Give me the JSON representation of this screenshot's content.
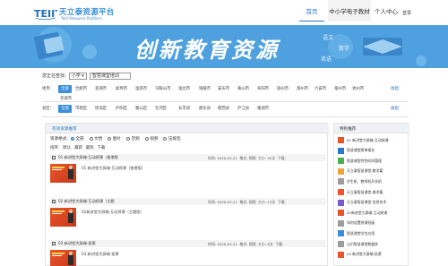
{
  "header": {
    "logo_mark": "TEIIT",
    "logo_cn": "天立泰资源平台",
    "logo_en": "Teiit Resource Platform",
    "nav": [
      "首页",
      "中小学电子教材",
      "个人中心"
    ],
    "login": "登录"
  },
  "banner": {
    "title": "创新教育资源",
    "color": "#4ea0df"
  },
  "search": {
    "label": "您正在查找:",
    "stage": "小学",
    "keyword": "智慧课堂培训"
  },
  "filters": {
    "region_label": "地市:",
    "regions": [
      "全部",
      "合肥市",
      "芜湖市",
      "蚌埠市",
      "淮南市",
      "马鞍山市",
      "淮北市",
      "铜陵市",
      "安庆市",
      "黄山市",
      "阜阳市",
      "宿州市",
      "滁州市",
      "六安市",
      "亳州市",
      "池州市",
      "宣城市"
    ],
    "county_label": "县区:",
    "counties": [
      "全部",
      "市辖区",
      "瑶海区",
      "庐阳区",
      "蜀山区",
      "包河区",
      "长丰县",
      "肥东县",
      "肥西县",
      "庐江县",
      "巢湖市"
    ],
    "collapse": "收起"
  },
  "main": {
    "panel_title": "有效资源推荐",
    "format_label": "资源格式:",
    "formats": [
      "全部",
      "文档",
      "图片",
      "音频",
      "视频",
      "压缩包"
    ],
    "sort_label": "排序:",
    "sorts": [
      "默认",
      "最新",
      "最热",
      "下载"
    ],
    "items": [
      {
        "title": "01 新讲堂大屏端-互动授课（香港版",
        "subtitle": "01 新讲堂大屏端-互动授课（香港版）",
        "time": "时间: 2020-03-21",
        "format": "格式: 视频",
        "size": "大小: 52文",
        "downloads": "下载:"
      },
      {
        "title": "02 新讲堂大屏端-互动授课（主题",
        "subtitle": "02新讲堂大屏端-互动授课（主题版）",
        "time": "时间: 2020-03-21",
        "format": "格式: 视频",
        "size": "大小: 13文",
        "downloads": "下载:"
      },
      {
        "title": "03 新讲堂大屏端-投票",
        "subtitle": "03 新讲堂大屏端-投票",
        "time": "时间: 2020-03-21",
        "format": "格式: 视频",
        "size": "大小: 8文",
        "downloads": "下载:"
      }
    ]
  },
  "side": {
    "title": "特别推荐",
    "items": [
      {
        "label": "01 新讲堂大屏端-互动授课",
        "color": "#e8552c"
      },
      {
        "label": "智慧课堂简单报名",
        "color": "#2a78c8"
      },
      {
        "label": "智慧课堂特色时间管理",
        "color": "#4caf50"
      },
      {
        "label": "天立泰智慧课堂-数学篇",
        "color": "#f2a23a"
      },
      {
        "label": "学生机、教师机开关机",
        "color": "#9c9c9c"
      },
      {
        "label": "天立泰智慧课堂-美术篇",
        "color": "#e8552c"
      },
      {
        "label": "天立泰智慧课堂-信息技术",
        "color": "#7a5ac8"
      },
      {
        "label": "02新讲堂大屏端-互动授课",
        "color": "#e8552c"
      },
      {
        "label": "如何设置授课班级",
        "color": "#9c9c9c"
      },
      {
        "label": "智慧课堂学生应用",
        "color": "#3a8fd6"
      },
      {
        "label": "认识智慧课堂数据库",
        "color": "#9c9c9c"
      },
      {
        "label": "03 新讲堂大屏端-投票",
        "color": "#e8552c"
      }
    ]
  }
}
